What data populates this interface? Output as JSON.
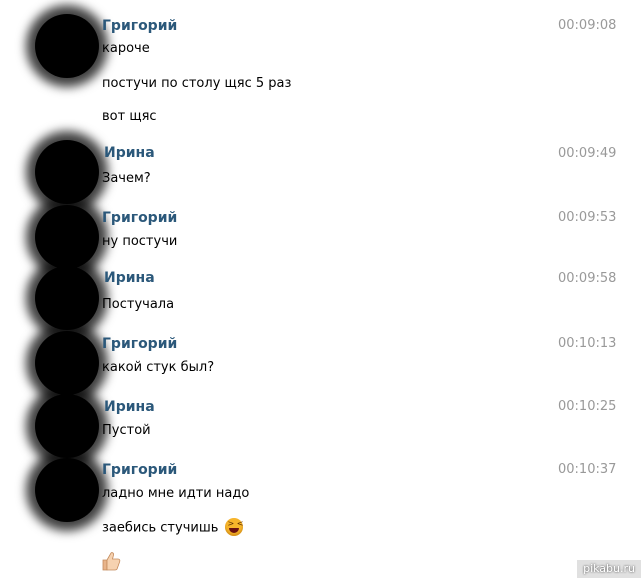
{
  "messages": [
    {
      "sender": "Григорий",
      "time": "00:09:08",
      "lines": [
        "кароче",
        "постучи по столу щяс 5 раз",
        "вот щяс"
      ]
    },
    {
      "sender": "Ирина",
      "time": "00:09:49",
      "lines": [
        "Зачем?"
      ]
    },
    {
      "sender": "Григорий",
      "time": "00:09:53",
      "lines": [
        "ну постучи"
      ]
    },
    {
      "sender": "Ирина",
      "time": "00:09:58",
      "lines": [
        "Постучала"
      ]
    },
    {
      "sender": "Григорий",
      "time": "00:10:13",
      "lines": [
        "какой стук был?"
      ]
    },
    {
      "sender": "Ирина",
      "time": "00:10:25",
      "lines": [
        "Пустой"
      ]
    },
    {
      "sender": "Григорий",
      "time": "00:10:37",
      "lines": [
        "ладно мне идти надо",
        "заебись стучишь"
      ]
    }
  ],
  "icons": [
    "laughing-emoji-icon",
    "thumbs-up-emoji-icon"
  ],
  "colors": {
    "sender_name": "#2b587a",
    "timestamp": "#999999",
    "avatar_blur": "#000000"
  },
  "watermark": "pikabu.ru"
}
